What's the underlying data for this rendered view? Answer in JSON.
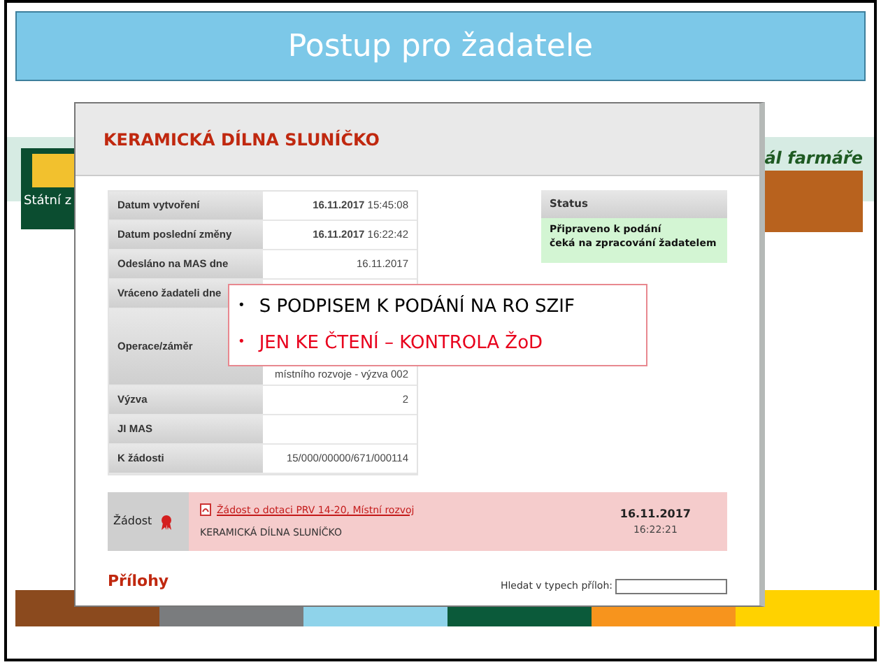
{
  "slide_title": "Postup pro žadatele",
  "background_page": {
    "logo_caption": "Státní z",
    "banner_caption": "ál farmáře"
  },
  "dialog": {
    "title": "KERAMICKÁ DÍLNA SLUNÍČKO",
    "details": [
      {
        "label": "Datum vytvoření",
        "value": "**16.11.2017** 15:45:08"
      },
      {
        "label": "Datum poslední změny",
        "value": "**16.11.2017** 16:22:42"
      },
      {
        "label": "Odesláno na MAS dne",
        "value": "16.11.2017"
      },
      {
        "label": "Vráceno žadateli dne"
      },
      {
        "label": "Operace/záměr",
        "value": "místního rozvoje - výzva 002"
      },
      {
        "label": "Výzva",
        "value": "2"
      },
      {
        "label": "JI MAS"
      },
      {
        "label": "K žádosti",
        "value": "15/000/00000/671/000114"
      }
    ],
    "status": {
      "heading": "Status",
      "lines": [
        "Připraveno k podání",
        "čeká na zpracování žadatelem"
      ]
    },
    "request": {
      "label": "Žádost",
      "link": "Žádost o dotaci PRV 14-20, Místní rozvoj",
      "name": "KERAMICKÁ DÍLNA SLUNÍČKO",
      "date": "16.11.2017",
      "time": "16:22:21"
    },
    "attachments": {
      "heading": "Přílohy",
      "search_label": "Hledat v typech příloh:"
    }
  },
  "callout": {
    "items": [
      {
        "bullet": "•",
        "text": "S PODPISEM K PODÁNÍ NA RO SZIF",
        "color": "#000000"
      },
      {
        "bullet": "•",
        "text": "JEN KE ČTENÍ – KONTROLA ŽoD",
        "color": "#e8001c"
      }
    ]
  }
}
